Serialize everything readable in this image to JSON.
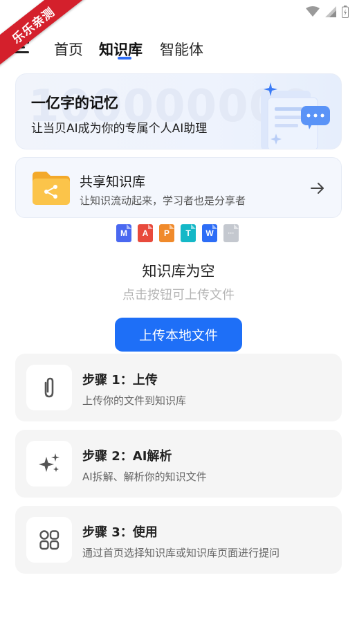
{
  "status_bar": {
    "icons": [
      "wifi-icon",
      "signal-icon",
      "battery-icon"
    ],
    "ribbon_text": "乐乐亲测"
  },
  "nav": {
    "tabs": [
      {
        "label": "首页",
        "active": false
      },
      {
        "label": "知识库",
        "active": true
      },
      {
        "label": "智能体",
        "active": false
      }
    ],
    "accent_color": "#2d6df6"
  },
  "banner": {
    "background_number": "100000000",
    "title": "一亿字的记忆",
    "subtitle": "让当贝AI成为你的专属个人AI助理"
  },
  "shared_kb": {
    "title": "共享知识库",
    "subtitle": "让知识流动起来，学习者也是分享者",
    "icon": "folder-share-icon"
  },
  "file_types": [
    {
      "letter": "M",
      "color": "#4a68f0",
      "name": "markdown-file-icon"
    },
    {
      "letter": "A",
      "color": "#e84a3c",
      "name": "pdf-file-icon"
    },
    {
      "letter": "P",
      "color": "#f08a2b",
      "name": "ppt-file-icon"
    },
    {
      "letter": "T",
      "color": "#14b8c7",
      "name": "txt-file-icon"
    },
    {
      "letter": "W",
      "color": "#2d6df6",
      "name": "word-file-icon"
    },
    {
      "letter": "···",
      "color": "#c4c8cf",
      "name": "other-file-icon"
    }
  ],
  "empty_state": {
    "title": "知识库为空",
    "subtitle": "点击按钮可上传文件"
  },
  "upload_button": {
    "label": "上传本地文件",
    "color": "#1e6ff7"
  },
  "steps": [
    {
      "title": "步骤 1：上传",
      "description": "上传你的文件到知识库",
      "icon": "paperclip-icon"
    },
    {
      "title": "步骤 2：AI解析",
      "description": "AI拆解、解析你的知识文件",
      "icon": "sparkles-icon"
    },
    {
      "title": "步骤 3：使用",
      "description": "通过首页选择知识库或知识库页面进行提问",
      "icon": "apps-grid-icon"
    }
  ]
}
